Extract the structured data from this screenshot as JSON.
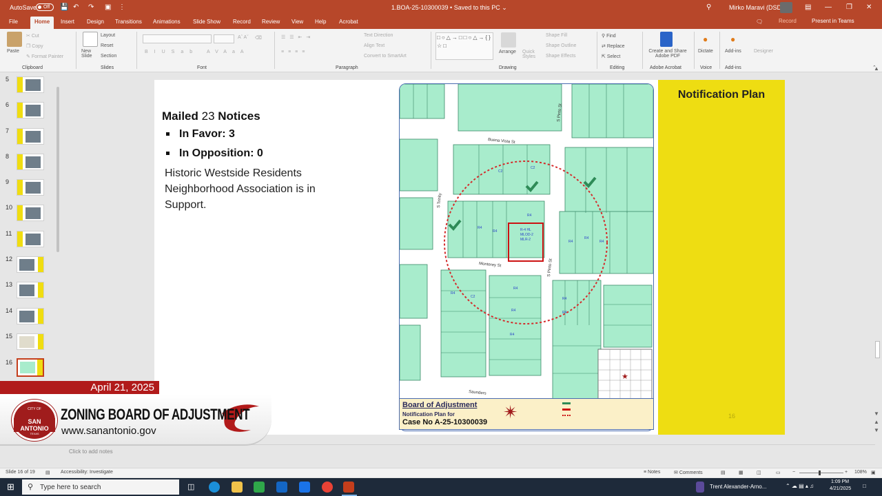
{
  "titlebar": {
    "autosave_label": "AutoSave",
    "autosave_state": "Off",
    "document": "1.BOA-25-10300039 • Saved to this PC ⌄",
    "user": "Mirko Maravi (DSD)"
  },
  "menu": {
    "tabs": [
      "File",
      "Home",
      "Insert",
      "Design",
      "Transitions",
      "Animations",
      "Slide Show",
      "Record",
      "Review",
      "View",
      "Help",
      "Acrobat"
    ],
    "active": "Home",
    "record": "Record",
    "present": "Present in Teams"
  },
  "ribbon": {
    "clipboard": {
      "paste": "Paste",
      "cut": "Cut",
      "copy": "Copy",
      "format_painter": "Format Painter",
      "label": "Clipboard"
    },
    "slides": {
      "new_slide": "New Slide",
      "layout": "Layout",
      "reset": "Reset",
      "section": "Section",
      "label": "Slides"
    },
    "font": {
      "label": "Font"
    },
    "paragraph": {
      "text_direction": "Text Direction",
      "align_text": "Align Text",
      "smartart": "Convert to SmartArt",
      "label": "Paragraph"
    },
    "drawing": {
      "arrange": "Arrange",
      "quick_styles": "Quick Styles",
      "shape_fill": "Shape Fill",
      "shape_outline": "Shape Outline",
      "shape_effects": "Shape Effects",
      "label": "Drawing"
    },
    "editing": {
      "find": "Find",
      "replace": "Replace",
      "select": "Select",
      "label": "Editing"
    },
    "acrobat": {
      "create": "Create and Share Adobe PDF",
      "label": "Adobe Acrobat"
    },
    "voice": {
      "dictate": "Dictate",
      "label": "Voice"
    },
    "addins": {
      "addins": "Add-ins",
      "designer": "Designer",
      "label": "Add-ins"
    }
  },
  "thumbnails": {
    "numbers": [
      "5",
      "6",
      "7",
      "8",
      "9",
      "10",
      "11",
      "12",
      "13",
      "14",
      "15",
      "16"
    ],
    "selected": "16"
  },
  "slide": {
    "mailed_prefix": "Mailed ",
    "mailed_count": "23",
    "mailed_suffix": " Notices",
    "in_favor": "In Favor: 3",
    "in_opposition": "In Opposition: 0",
    "support_text": "Historic Westside Residents Neighborhood Association is in Support.",
    "panel_title": "Notification Plan",
    "page_number": "16",
    "map": {
      "streets": {
        "buena_vista": "Buena Vista St",
        "monterey": "Monterey St",
        "saunders": "Saunders",
        "trinity": "S Trinity",
        "pinto": "S Pinto St"
      },
      "legend_title": "Board of Adjustment",
      "legend_sub": "Notification Plan for",
      "case": "Case No A-25-10300039",
      "colors": {
        "parcel": "#a8eccc",
        "radius": "#d42a2a",
        "subject": "#cc1111",
        "check": "#2e8b57"
      }
    }
  },
  "notes": {
    "placeholder": "Click to add notes"
  },
  "status": {
    "slide": "Slide 16 of 19",
    "accessibility": "Accessibility: Investigate",
    "notes": "Notes",
    "comments": "Comments",
    "zoom": "108%"
  },
  "taskbar": {
    "search_placeholder": "Type here to search",
    "user": "Trent Alexander-Arno...",
    "time": "1:09 PM",
    "date": "4/21/2025"
  },
  "overlay": {
    "date": "April 21, 2025",
    "seal_top": "CITY OF",
    "seal_city": "SAN ANTONIO",
    "seal_bottom": "TEXAS",
    "title": "ZONING BOARD OF ADJUSTMENT",
    "website": "www.sanantonio.gov"
  }
}
